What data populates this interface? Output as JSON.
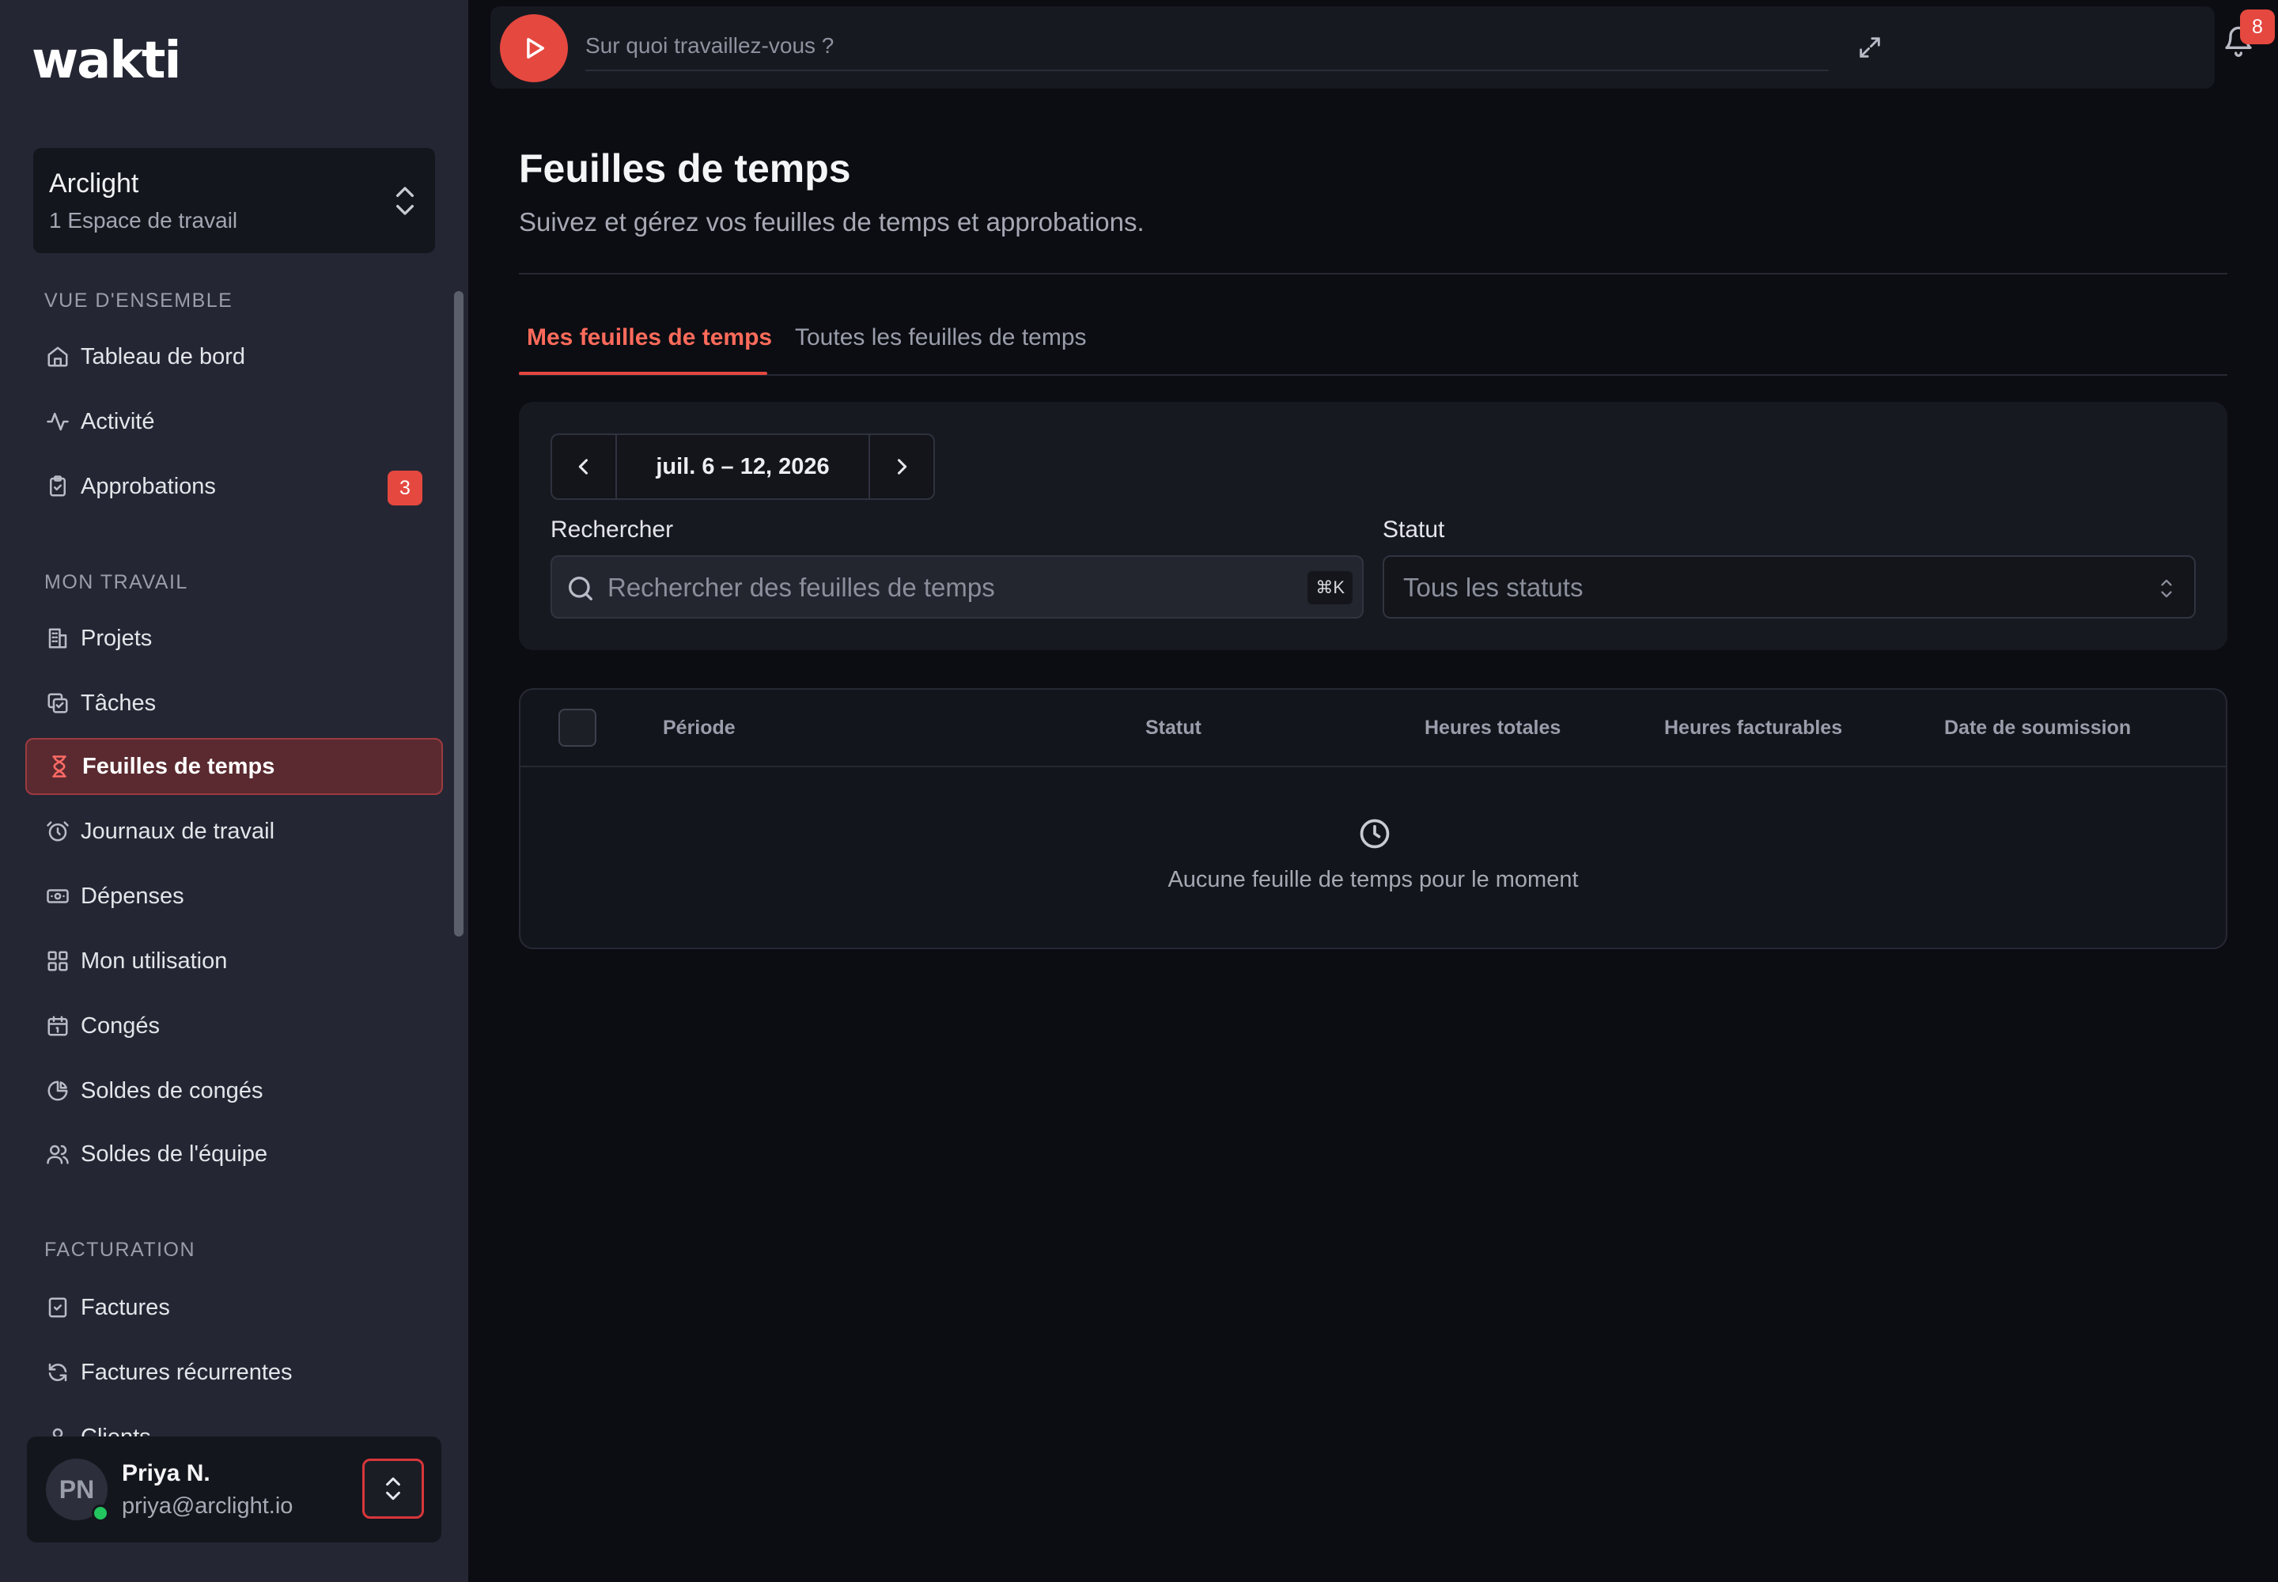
{
  "app": {
    "logo": "wakti"
  },
  "workspace": {
    "name": "Arclight",
    "subtitle": "1 Espace de travail"
  },
  "sidebar": {
    "sections": [
      {
        "label": "VUE D'ENSEMBLE"
      },
      {
        "label": "MON TRAVAIL"
      },
      {
        "label": "FACTURATION"
      }
    ],
    "items": [
      {
        "label": "Tableau de bord",
        "icon": "home-icon"
      },
      {
        "label": "Activité",
        "icon": "activity-icon"
      },
      {
        "label": "Approbations",
        "icon": "clipboard-check-icon",
        "badge": "3"
      },
      {
        "label": "Projets",
        "icon": "building-icon"
      },
      {
        "label": "Tâches",
        "icon": "copy-check-icon"
      },
      {
        "label": "Feuilles de temps",
        "icon": "hourglass-icon",
        "active": true
      },
      {
        "label": "Journaux de travail",
        "icon": "alarm-clock-icon"
      },
      {
        "label": "Dépenses",
        "icon": "banknote-icon"
      },
      {
        "label": "Mon utilisation",
        "icon": "grid-icon"
      },
      {
        "label": "Congés",
        "icon": "calendar-icon"
      },
      {
        "label": "Soldes de congés",
        "icon": "pie-chart-icon"
      },
      {
        "label": "Soldes de l'équipe",
        "icon": "users-icon"
      },
      {
        "label": "Factures",
        "icon": "file-check-icon"
      },
      {
        "label": "Factures récurrentes",
        "icon": "refresh-icon"
      },
      {
        "label": "Clients",
        "icon": "user-icon"
      }
    ]
  },
  "user": {
    "initials": "PN",
    "name": "Priya N.",
    "email": "priya@arclight.io"
  },
  "topbar": {
    "task_placeholder": "Sur quoi travaillez-vous ?",
    "notification_count": "8"
  },
  "page": {
    "title": "Feuilles de temps",
    "subtitle": "Suivez et gérez vos feuilles de temps et approbations."
  },
  "tabs": [
    {
      "label": "Mes feuilles de temps",
      "active": true
    },
    {
      "label": "Toutes les feuilles de temps",
      "active": false
    }
  ],
  "filters": {
    "date_range": "juil. 6 – 12, 2026",
    "search_label": "Rechercher",
    "search_placeholder": "Rechercher des feuilles de temps",
    "search_shortcut": "⌘K",
    "status_label": "Statut",
    "status_value": "Tous les statuts"
  },
  "table": {
    "columns": [
      "Période",
      "Statut",
      "Heures totales",
      "Heures facturables",
      "Date de soumission"
    ],
    "empty_message": "Aucune feuille de temps pour le moment"
  },
  "colors": {
    "accent": "#e5483f",
    "sidebar_bg": "#242733",
    "main_bg": "#0c0d12",
    "online": "#22c55e"
  }
}
